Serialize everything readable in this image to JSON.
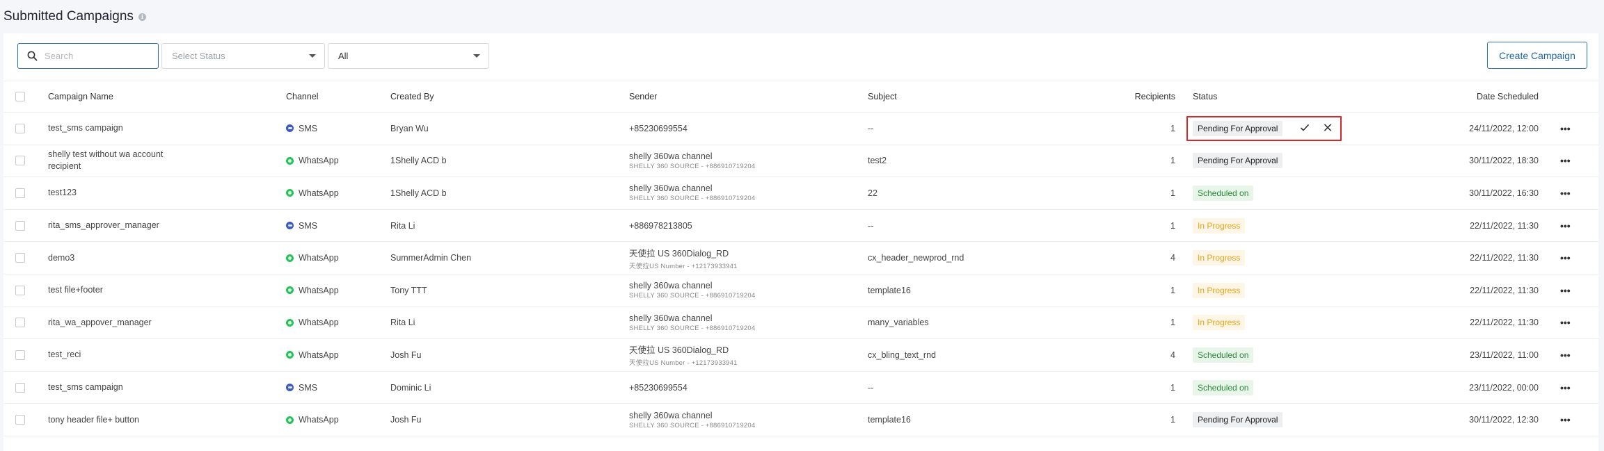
{
  "page": {
    "title": "Submitted Campaigns"
  },
  "filters": {
    "search_placeholder": "Search",
    "status_placeholder": "Select Status",
    "type_value": "All"
  },
  "create_button": "Create Campaign",
  "columns": {
    "name": "Campaign Name",
    "channel": "Channel",
    "created_by": "Created By",
    "sender": "Sender",
    "subject": "Subject",
    "recipients": "Recipients",
    "status": "Status",
    "date": "Date Scheduled"
  },
  "rows": [
    {
      "name": "test_sms campaign",
      "channel": "SMS",
      "created_by": "Bryan Wu",
      "sender": "+85230699554",
      "sender_sub": "",
      "subject": "--",
      "recipients": "1",
      "status": "Pending For Approval",
      "date": "24/11/2022, 12:00"
    },
    {
      "name": "shelly test without wa account recipient",
      "channel": "WhatsApp",
      "created_by": "1Shelly ACD b",
      "sender": "shelly 360wa channel",
      "sender_sub": "SHELLY 360 SOURCE - +886910719204",
      "subject": "test2",
      "recipients": "1",
      "status": "Pending For Approval",
      "date": "30/11/2022, 18:30"
    },
    {
      "name": "test123",
      "channel": "WhatsApp",
      "created_by": "1Shelly ACD b",
      "sender": "shelly 360wa channel",
      "sender_sub": "SHELLY 360 SOURCE - +886910719204",
      "subject": "22",
      "recipients": "1",
      "status": "Scheduled on",
      "date": "30/11/2022, 16:30"
    },
    {
      "name": "rita_sms_approver_manager",
      "channel": "SMS",
      "created_by": "Rita Li",
      "sender": "+886978213805",
      "sender_sub": "",
      "subject": "--",
      "recipients": "1",
      "status": "In Progress",
      "date": "22/11/2022, 11:30"
    },
    {
      "name": "demo3",
      "channel": "WhatsApp",
      "created_by": "SummerAdmin Chen",
      "sender": "天使拉 US 360Dialog_RD",
      "sender_sub": "天使拉US Number - +12173933941",
      "subject": "cx_header_newprod_rnd",
      "recipients": "4",
      "status": "In Progress",
      "date": "22/11/2022, 11:30"
    },
    {
      "name": "test file+footer",
      "channel": "WhatsApp",
      "created_by": "Tony TTT",
      "sender": "shelly 360wa channel",
      "sender_sub": "SHELLY 360 SOURCE - +886910719204",
      "subject": "template16",
      "recipients": "1",
      "status": "In Progress",
      "date": "22/11/2022, 11:30"
    },
    {
      "name": "rita_wa_appover_manager",
      "channel": "WhatsApp",
      "created_by": "Rita Li",
      "sender": "shelly 360wa channel",
      "sender_sub": "SHELLY 360 SOURCE - +886910719204",
      "subject": "many_variables",
      "recipients": "1",
      "status": "In Progress",
      "date": "22/11/2022, 11:30"
    },
    {
      "name": "test_reci",
      "channel": "WhatsApp",
      "created_by": "Josh Fu",
      "sender": "天使拉 US 360Dialog_RD",
      "sender_sub": "天使拉US Number - +12173933941",
      "subject": "cx_bling_text_rnd",
      "recipients": "4",
      "status": "Scheduled on",
      "date": "23/11/2022, 11:00"
    },
    {
      "name": "test_sms campaign",
      "channel": "SMS",
      "created_by": "Dominic Li",
      "sender": "+85230699554",
      "sender_sub": "",
      "subject": "--",
      "recipients": "1",
      "status": "Scheduled on",
      "date": "23/11/2022, 00:00"
    },
    {
      "name": "tony header file+ button",
      "channel": "WhatsApp",
      "created_by": "Josh Fu",
      "sender": "shelly 360wa channel",
      "sender_sub": "SHELLY 360 SOURCE - +886910719204",
      "subject": "template16",
      "recipients": "1",
      "status": "Pending For Approval",
      "date": "30/11/2022, 12:30"
    }
  ],
  "more_glyph": "•••",
  "colors": {
    "accent": "#2b6cb0",
    "highlight": "#d9262c",
    "whatsapp": "#25c25a",
    "sms": "#3d5bbf"
  }
}
